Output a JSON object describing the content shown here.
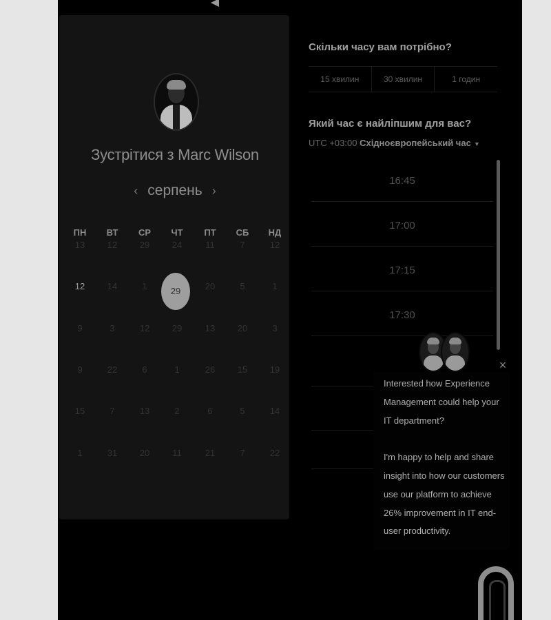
{
  "booking": {
    "title": "Зустрітися з Marc Wilson",
    "month": "серпень",
    "prev_icon": "chevron-left-icon",
    "next_icon": "chevron-right-icon",
    "weekdays": [
      "ПН",
      "ВТ",
      "СР",
      "ЧТ",
      "ПТ",
      "СБ",
      "НД"
    ],
    "weeks": [
      [
        "13",
        "12",
        "29",
        "24",
        "11",
        "7",
        "12"
      ],
      [
        "12",
        "14",
        "1",
        "29",
        "20",
        "5",
        "1"
      ],
      [
        "9",
        "3",
        "12",
        "29",
        "13",
        "20",
        "3"
      ],
      [
        "9",
        "22",
        "6",
        "1",
        "26",
        "15",
        "19"
      ],
      [
        "15",
        "7",
        "13",
        "2",
        "6",
        "5",
        "14"
      ],
      [
        "1",
        "31",
        "20",
        "11",
        "21",
        "7",
        "22"
      ]
    ],
    "selected_day": "29"
  },
  "duration": {
    "question": "Скільки часу вам потрібно?",
    "options": [
      "15 хвилин",
      "30 хвилин",
      "1 годин"
    ]
  },
  "time": {
    "question": "Який час є найліпшим для вас?",
    "tz_offset": "UTC +03:00",
    "tz_name": "Східноєвропейський час",
    "slots": [
      "16:45",
      "17:00",
      "17:15",
      "17:30"
    ]
  },
  "chat": {
    "message_1": "Interested how Experience Management could help your IT department?",
    "message_2": "I'm happy to help and share insight into how our customers use our platform to achieve 26% improvement in IT end-user productivity.",
    "close_icon": "close-icon",
    "launcher_icon": "chat-launcher-icon"
  }
}
